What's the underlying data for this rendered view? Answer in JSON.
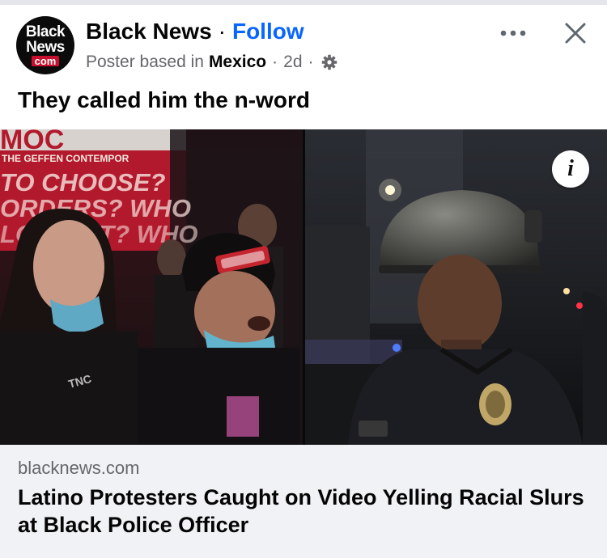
{
  "post": {
    "avatar_text": [
      "Black",
      "News",
      "com"
    ],
    "page_name": "Black News",
    "separator": "·",
    "follow_label": "Follow",
    "meta_prefix": "Poster based in",
    "location": "Mexico",
    "time": "2d",
    "audience_icon": "gear-icon",
    "caption": "They called him the n-word"
  },
  "media": {
    "image_text_line1": "MOC",
    "image_text_line2": "THE GEFFEN CONTEMPOR",
    "image_text_line3": "TO CHOOSE?",
    "image_text_line4": "ORDERS? WHO",
    "image_text_line5": "LOTTEST? WHO",
    "hat_text": "",
    "info_label": "i"
  },
  "link_preview": {
    "domain": "blacknews.com",
    "title": "Latino Protesters Caught on Video Yelling Racial Slurs at Black Police Officer"
  },
  "colors": {
    "follow": "#0866ff",
    "secondary_text": "#65676b",
    "primary_text": "#050505",
    "preview_bg": "#f0f2f5"
  }
}
